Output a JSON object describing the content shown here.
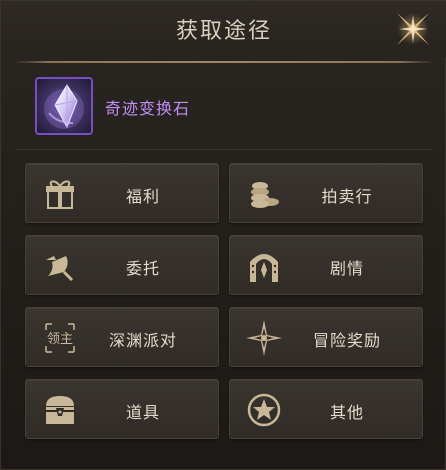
{
  "window": {
    "title": "获取途径"
  },
  "item": {
    "name": "奇迹变换石",
    "icon": "crystal-icon",
    "rarity_color": "#c28cf6"
  },
  "sources": [
    {
      "label": "福利",
      "icon": "gift-icon"
    },
    {
      "label": "拍卖行",
      "icon": "coins-icon"
    },
    {
      "label": "委托",
      "icon": "scroll-quill-icon"
    },
    {
      "label": "剧情",
      "icon": "archway-icon"
    },
    {
      "label": "深渊派对",
      "icon": "boss-text-icon",
      "icon_text": "领主"
    },
    {
      "label": "冒险奖励",
      "icon": "compass-star-icon"
    },
    {
      "label": "道具",
      "icon": "chest-icon"
    },
    {
      "label": "其他",
      "icon": "star-circle-icon"
    }
  ],
  "colors": {
    "accent_gold": "#c9a874",
    "text": "#e3dccd",
    "title": "#d8cfbf"
  }
}
